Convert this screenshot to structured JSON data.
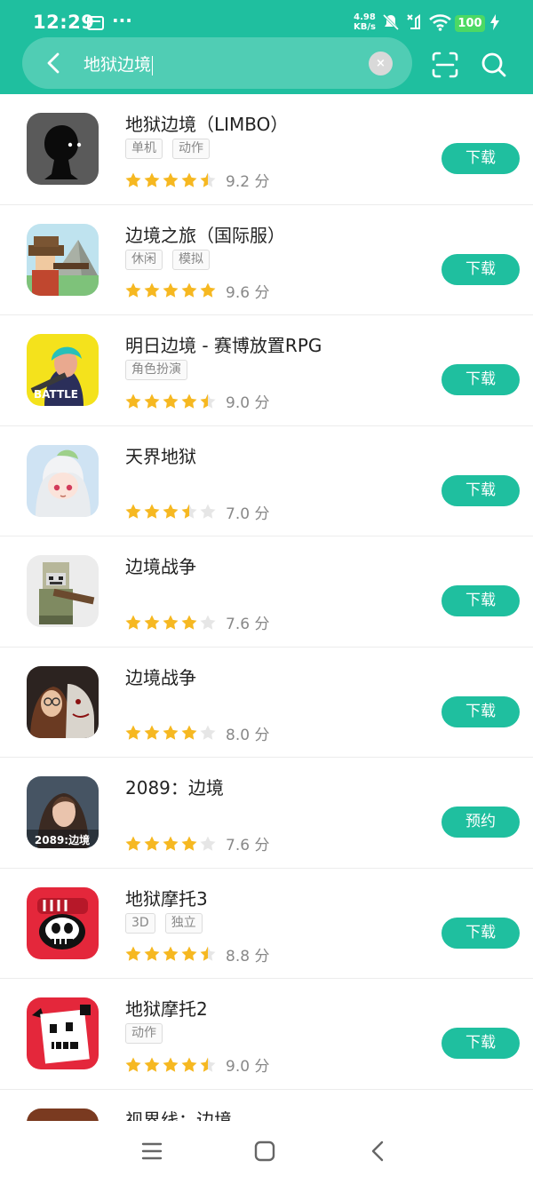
{
  "status_bar": {
    "time": "12:29",
    "dots": "···",
    "net_speed_value": "4.98",
    "net_speed_unit": "KB/s",
    "battery": "100"
  },
  "search": {
    "query": "地狱边境",
    "clear_label": "×"
  },
  "apps": [
    {
      "name": "地狱边境（LIMBO）",
      "tags": [
        "单机",
        "动作"
      ],
      "rating": 4.5,
      "score": "9.2 分",
      "action": "下载"
    },
    {
      "name": "边境之旅（国际服）",
      "tags": [
        "休闲",
        "模拟"
      ],
      "rating": 5,
      "score": "9.6 分",
      "action": "下载"
    },
    {
      "name": "明日边境 - 赛博放置RPG",
      "tags": [
        "角色扮演"
      ],
      "rating": 4.5,
      "score": "9.0 分",
      "action": "下载"
    },
    {
      "name": "天界地狱",
      "tags": [],
      "rating": 3.5,
      "score": "7.0 分",
      "action": "下载"
    },
    {
      "name": "边境战争",
      "tags": [],
      "rating": 4,
      "score": "7.6 分",
      "action": "下载"
    },
    {
      "name": "边境战争",
      "tags": [],
      "rating": 4,
      "score": "8.0 分",
      "action": "下载"
    },
    {
      "name": "2089：边境",
      "tags": [],
      "rating": 4,
      "score": "7.6 分",
      "action": "预约",
      "icon_caption": "2089:边境"
    },
    {
      "name": "地狱摩托3",
      "tags": [
        "3D",
        "独立"
      ],
      "rating": 4.5,
      "score": "8.8 分",
      "action": "下载"
    },
    {
      "name": "地狱摩托2",
      "tags": [
        "动作"
      ],
      "rating": 4.5,
      "score": "9.0 分",
      "action": "下载"
    },
    {
      "name": "视界线：边境",
      "tags": [],
      "rating": 0,
      "score": "",
      "action": ""
    }
  ],
  "colors": {
    "accent": "#1fbf9f",
    "star": "#f6b821",
    "star_empty": "#e6e6e6"
  },
  "icons": {
    "back": "chevron-left-icon",
    "scan": "scan-icon",
    "search": "search-icon",
    "menu": "menu-icon",
    "home": "home-icon",
    "nav_back": "nav-back-icon"
  }
}
